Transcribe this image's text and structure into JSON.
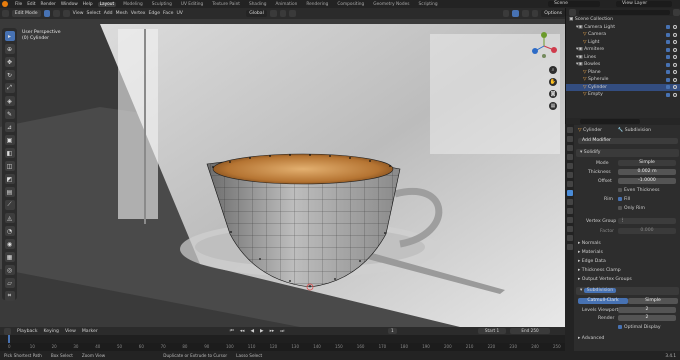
{
  "topbar": {
    "menus": [
      "File",
      "Edit",
      "Render",
      "Window",
      "Help"
    ],
    "tabs": [
      "Layout",
      "Modeling",
      "Sculpting",
      "UV Editing",
      "Texture Paint",
      "Shading",
      "Animation",
      "Rendering",
      "Compositing",
      "Geometry Nodes",
      "Scripting"
    ],
    "active_tab": "Layout",
    "scene": "Scene",
    "view_layer": "View Layer"
  },
  "viewport_header": {
    "mode": "Edit Mode",
    "menus": [
      "View",
      "Select",
      "Add",
      "Mesh",
      "Vertex",
      "Edge",
      "Face",
      "UV"
    ],
    "transform_orientation": "Global",
    "options": "Options"
  },
  "viewport_info": {
    "view": "User Perspective",
    "object": "(0) Cylinder"
  },
  "outliner": {
    "title": "Scene Collection",
    "rows": [
      {
        "label": "Scene Collection",
        "indent": 0
      },
      {
        "label": "Camera Light",
        "indent": 1
      },
      {
        "label": "Camera",
        "indent": 2
      },
      {
        "label": "Light",
        "indent": 2
      },
      {
        "label": "Armitere",
        "indent": 1
      },
      {
        "label": "Lines",
        "indent": 1
      },
      {
        "label": "Bowles",
        "indent": 1
      },
      {
        "label": "Plane",
        "indent": 2
      },
      {
        "label": "Spherule",
        "indent": 2
      },
      {
        "label": "Cylinder",
        "indent": 2,
        "selected": true
      },
      {
        "label": "Empty",
        "indent": 2
      }
    ]
  },
  "properties": {
    "object_name": "Cylinder",
    "modifier_name": "Subdivision",
    "add_modifier": "Add Modifier",
    "solidify": {
      "name": "Solidify",
      "mode_label": "Mode",
      "mode_value": "Simple",
      "thickness_label": "Thickness",
      "thickness_value": "0.002 m",
      "offset_label": "Offset",
      "offset_value": "-1.0000",
      "even_thickness": "Even Thickness",
      "rim_label": "Rim",
      "fill": "Fill",
      "only_rim": "Only Rim",
      "vertex_group_label": "Vertex Group",
      "factor_label": "Factor",
      "factor_value": "0.000"
    },
    "subpanels": [
      "Normals",
      "Materials",
      "Edge Data",
      "Thickness Clamp",
      "Output Vertex Groups"
    ],
    "subdivision": {
      "name": "Subdivision",
      "type_a": "Catmull-Clark",
      "type_b": "Simple",
      "levels_viewport_label": "Levels Viewport",
      "levels_viewport_value": "2",
      "render_label": "Render",
      "render_value": "2",
      "optimal_display": "Optimal Display",
      "advanced": "Advanced"
    }
  },
  "timeline": {
    "menus": [
      "Playback",
      "Keying",
      "View",
      "Marker"
    ],
    "current_frame": "1",
    "start_label": "Start",
    "start": "1",
    "end_label": "End",
    "end": "250",
    "ticks": [
      "0",
      "10",
      "20",
      "30",
      "40",
      "50",
      "60",
      "70",
      "80",
      "90",
      "100",
      "110",
      "120",
      "130",
      "140",
      "150",
      "160",
      "170",
      "180",
      "190",
      "200",
      "210",
      "220",
      "230",
      "240",
      "250"
    ]
  },
  "statusbar": {
    "items": [
      "Pick Shortest Path",
      "Box Select",
      "Zoom View",
      "Duplicate or Extrude to Cursor",
      "Lasso Select"
    ],
    "version": "3.4.1"
  },
  "colors": {
    "accent": "#4772b3",
    "brand": "#e87d0d",
    "selected_row": "#334d80"
  },
  "tools": [
    "cursor-icon",
    "move-icon",
    "rotate-icon",
    "scale-icon",
    "transform-icon",
    "annotate-icon",
    "measure-icon",
    "add-cube-icon",
    "extrude-icon",
    "inset-icon",
    "bevel-icon",
    "loopcut-icon",
    "knife-icon",
    "polybuild-icon",
    "spin-icon",
    "smooth-icon",
    "edge-slide-icon",
    "shrink-icon",
    "shear-icon",
    "rip-icon"
  ]
}
